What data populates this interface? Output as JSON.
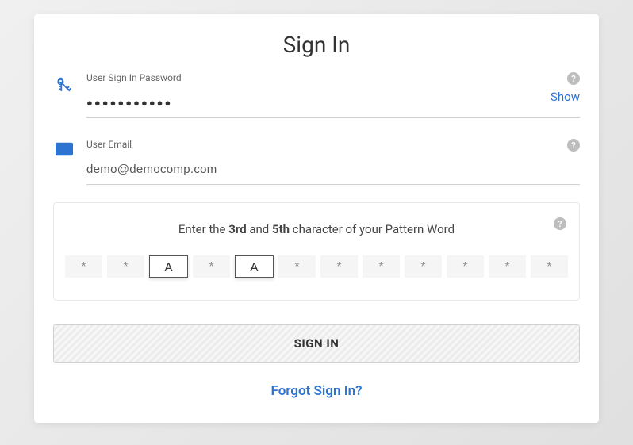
{
  "title": "Sign In",
  "password_field": {
    "label": "User Sign In Password",
    "masked_value": "●●●●●●●●●●●",
    "show_label": "Show"
  },
  "email_field": {
    "label": "User Email",
    "value": "demo@democomp.com"
  },
  "pattern": {
    "prompt_prefix": "Enter the ",
    "pos1": "3rd",
    "prompt_mid": " and ",
    "pos2": "5th",
    "prompt_suffix": " character of your Pattern Word",
    "cells": [
      {
        "value": "*",
        "active": false
      },
      {
        "value": "*",
        "active": false
      },
      {
        "value": "A",
        "active": true
      },
      {
        "value": "*",
        "active": false
      },
      {
        "value": "A",
        "active": true
      },
      {
        "value": "*",
        "active": false
      },
      {
        "value": "*",
        "active": false
      },
      {
        "value": "*",
        "active": false
      },
      {
        "value": "*",
        "active": false
      },
      {
        "value": "*",
        "active": false
      },
      {
        "value": "*",
        "active": false
      },
      {
        "value": "*",
        "active": false
      }
    ]
  },
  "signin_button": "SIGN IN",
  "forgot_link": "Forgot Sign In?",
  "colors": {
    "accent": "#2d73d2"
  }
}
